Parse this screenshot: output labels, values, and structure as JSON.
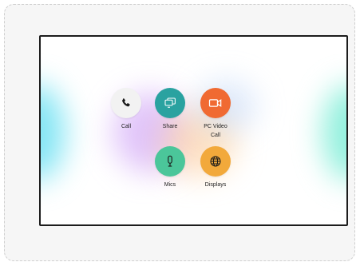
{
  "screen": {
    "actions": [
      {
        "id": "call",
        "label": "Call",
        "icon": "phone-icon",
        "color": "#f2f2f2"
      },
      {
        "id": "share",
        "label": "Share",
        "icon": "share-screen-icon",
        "color": "#2aa2a0"
      },
      {
        "id": "pc_video_call",
        "label": "PC Video Call",
        "icon": "video-camera-icon",
        "color": "#f06a32"
      },
      {
        "id": "mics",
        "label": "Mics",
        "icon": "microphone-icon",
        "color": "#4bc69a"
      },
      {
        "id": "displays",
        "label": "Displays",
        "icon": "globe-icon",
        "color": "#f2a93b"
      }
    ]
  }
}
